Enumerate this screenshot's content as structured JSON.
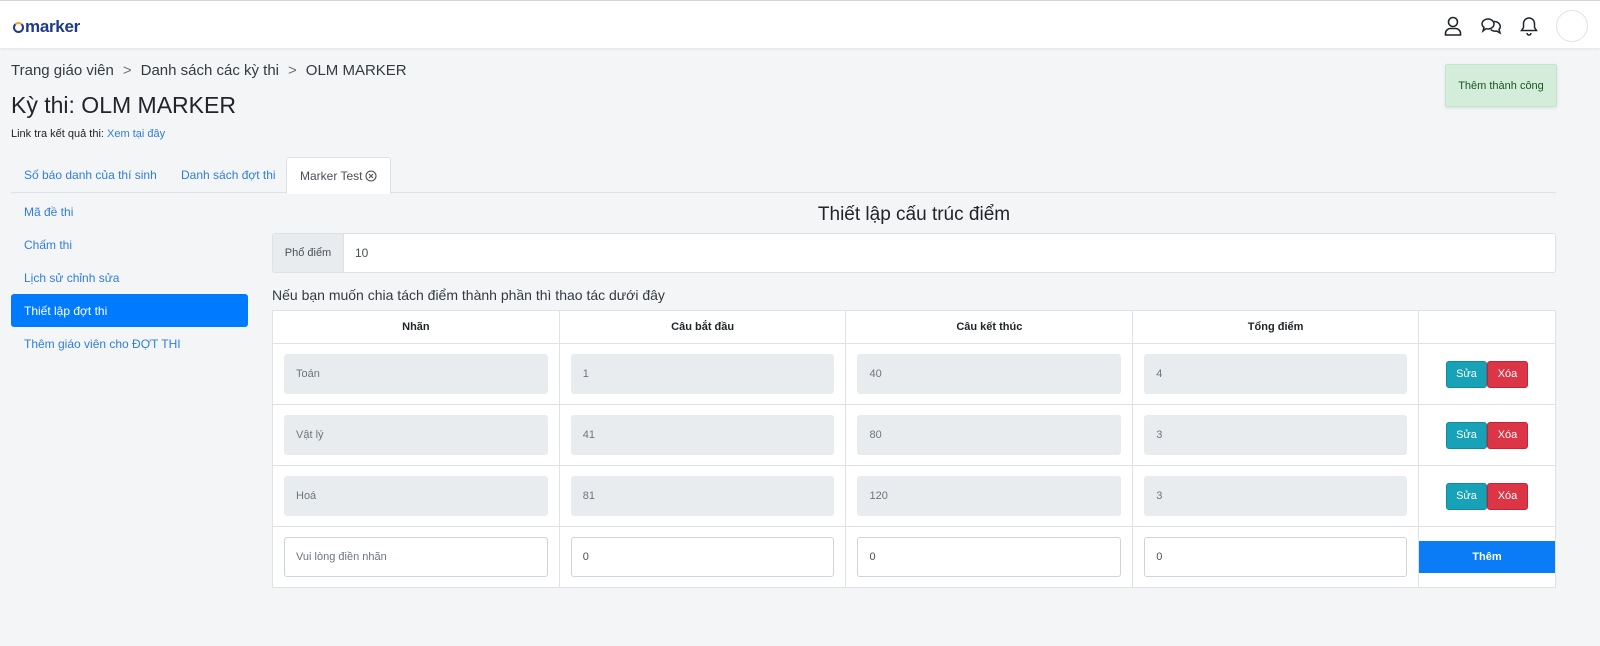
{
  "header": {
    "logo_text": "marker",
    "icons": [
      "user-icon",
      "chat-icon",
      "bell-icon",
      "avatar"
    ]
  },
  "breadcrumb": [
    "Trang giáo viên",
    "Danh sách các kỳ thi",
    "OLM MARKER"
  ],
  "breadcrumb_sep": ">",
  "page_title": "Kỳ thi: OLM MARKER",
  "result_link": {
    "label": "Link tra kết quả thi:",
    "link_text": "Xem tại đây"
  },
  "toast": "Thêm thành công",
  "tabs": [
    {
      "label": "Số báo danh của thí sinh"
    },
    {
      "label": "Danh sách đợt thi"
    },
    {
      "label": "Marker Test"
    }
  ],
  "sidebar": {
    "items": [
      {
        "label": "Mã đề thi"
      },
      {
        "label": "Chấm thi"
      },
      {
        "label": "Lịch sử chỉnh sửa"
      },
      {
        "label": "Thiết lập đợt thi"
      },
      {
        "label": "Thêm giáo viên cho ĐỢT THI"
      }
    ]
  },
  "main": {
    "title": "Thiết lập cấu trúc điểm",
    "score_label": "Phổ điểm",
    "score_value": "10",
    "hint": "Nếu bạn muốn chia tách điểm thành phần thì thao tác dưới đây",
    "columns": [
      "Nhãn",
      "Câu bắt đầu",
      "Câu kết thúc",
      "Tổng điểm",
      ""
    ],
    "rows": [
      {
        "label": "Toán",
        "start": "1",
        "end": "40",
        "total": "4"
      },
      {
        "label": "Vật lý",
        "start": "41",
        "end": "80",
        "total": "3"
      },
      {
        "label": "Hoá",
        "start": "81",
        "end": "120",
        "total": "3"
      }
    ],
    "edit_label": "Sửa",
    "delete_label": "Xóa",
    "new_row": {
      "label_placeholder": "Vui lòng điền nhãn",
      "start": "0",
      "end": "0",
      "total": "0"
    },
    "add_label": "Thêm"
  },
  "colors": {
    "primary": "#007bff",
    "link": "#2f7de1",
    "edit": "#17a2b8",
    "delete": "#dc3545",
    "toast_bg": "#d4edda"
  }
}
